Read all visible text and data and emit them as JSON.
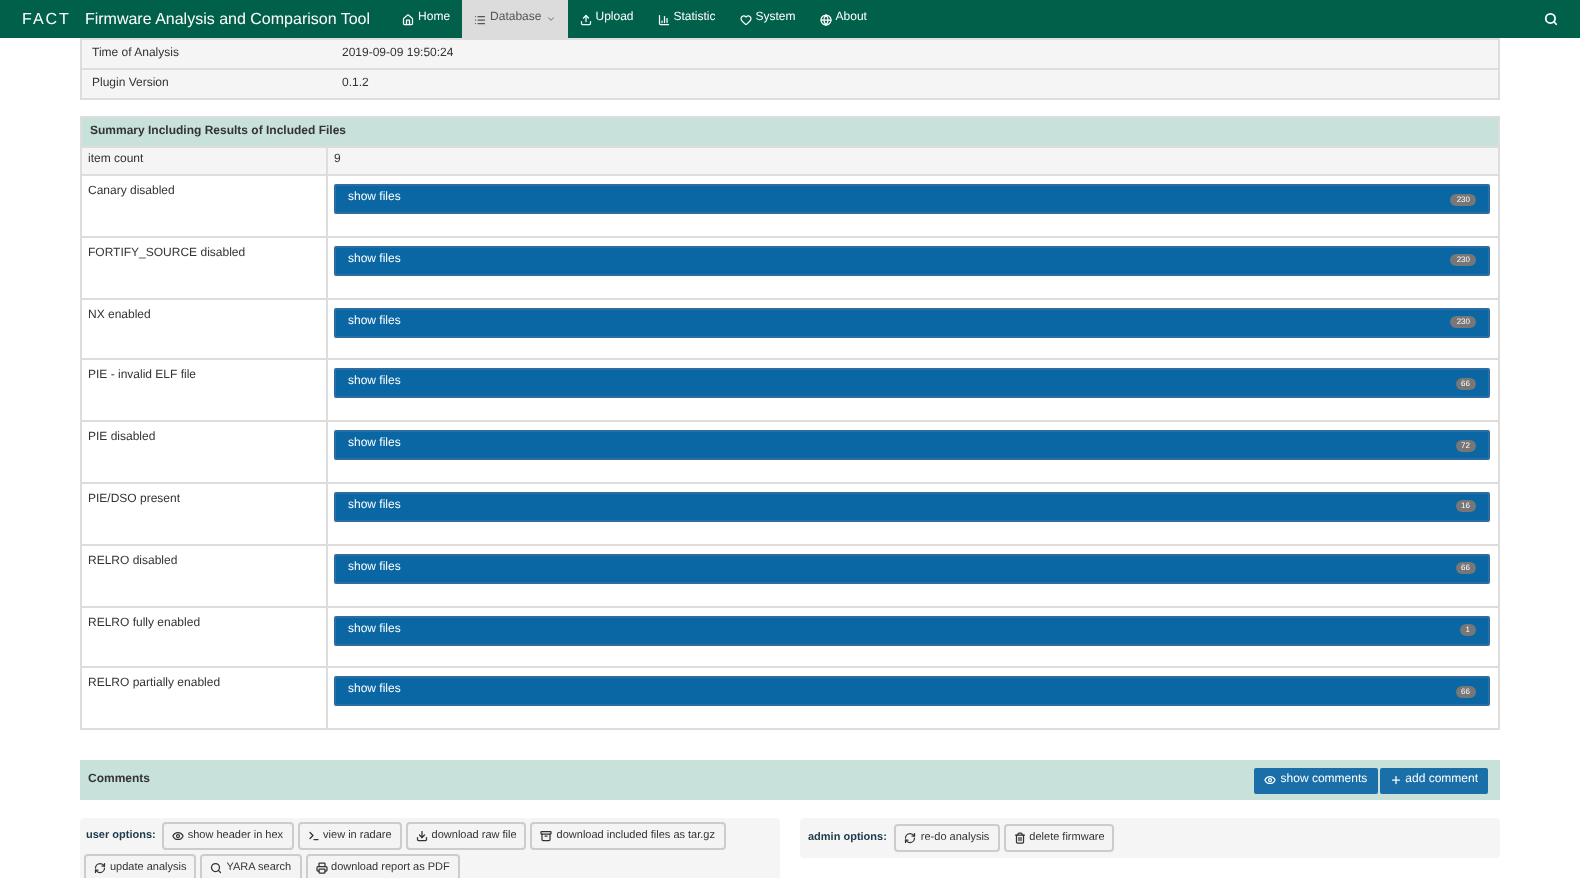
{
  "navbar": {
    "logo": "FACT",
    "title": "Firmware Analysis and Comparison Tool",
    "items": [
      {
        "label": "Home",
        "selected": false
      },
      {
        "label": "Database",
        "selected": true
      },
      {
        "label": "Upload",
        "selected": false
      },
      {
        "label": "Statistic",
        "selected": false
      },
      {
        "label": "System",
        "selected": false
      },
      {
        "label": "About",
        "selected": false
      }
    ]
  },
  "meta": [
    {
      "label": "Time of Analysis",
      "value": "2019-09-09 19:50:24"
    },
    {
      "label": "Plugin Version",
      "value": "0.1.2"
    }
  ],
  "summary": {
    "title": "Summary Including Results of Included Files",
    "count_label": "item count",
    "count": "9",
    "rows": [
      {
        "label": "Canary disabled",
        "button": "show files",
        "badge": "230"
      },
      {
        "label": "FORTIFY_SOURCE disabled",
        "button": "show files",
        "badge": "230"
      },
      {
        "label": "NX enabled",
        "button": "show files",
        "badge": "230"
      },
      {
        "label": "PIE - invalid ELF file",
        "button": "show files",
        "badge": "66"
      },
      {
        "label": "PIE disabled",
        "button": "show files",
        "badge": "72"
      },
      {
        "label": "PIE/DSO present",
        "button": "show files",
        "badge": "16"
      },
      {
        "label": "RELRO disabled",
        "button": "show files",
        "badge": "66"
      },
      {
        "label": "RELRO fully enabled",
        "button": "show files",
        "badge": "1"
      },
      {
        "label": "RELRO partially enabled",
        "button": "show files",
        "badge": "66"
      }
    ]
  },
  "comments": {
    "title": "Comments",
    "buttons": [
      "show comments",
      "add comment"
    ]
  },
  "user_options": {
    "label": "user options:",
    "buttons": [
      "show header in hex",
      "view in radare",
      "download raw file",
      "download included files as tar.gz",
      "update analysis",
      "YARA search",
      "download report as PDF"
    ]
  },
  "admin_options": {
    "label": "admin options:",
    "buttons": [
      "re-do analysis",
      "delete firmware"
    ]
  }
}
